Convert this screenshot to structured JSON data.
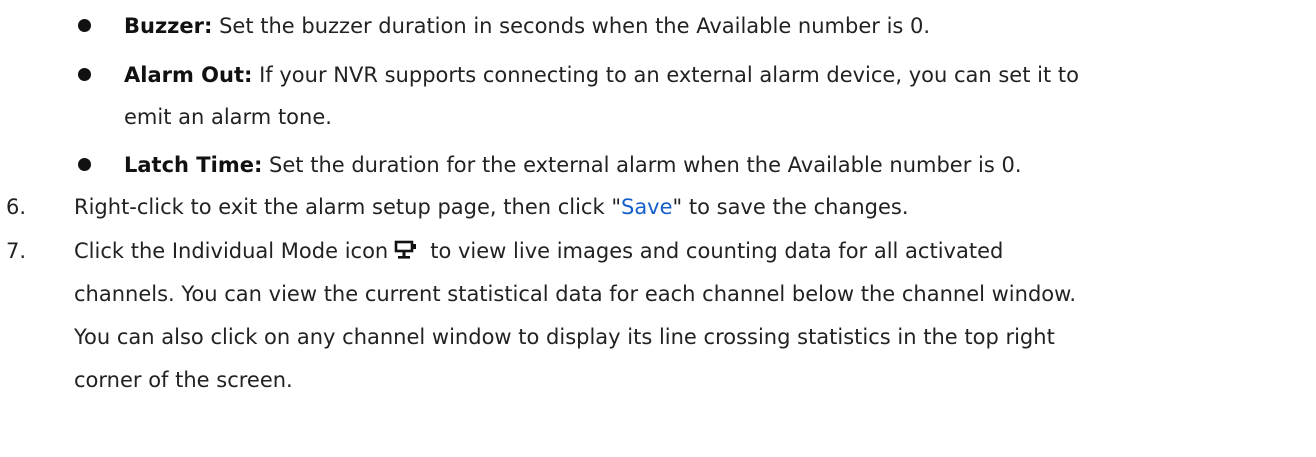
{
  "bullets": [
    {
      "term": "Buzzer:",
      "lines": [
        "Set the buzzer duration in seconds when the Available number is 0."
      ]
    },
    {
      "term": "Alarm Out:",
      "lines": [
        "If your NVR supports connecting to an external alarm device, you can set it to",
        "emit an alarm tone."
      ]
    },
    {
      "term": "Latch Time:",
      "lines": [
        "Set the duration for the external alarm when the Available number is 0."
      ]
    }
  ],
  "steps": [
    {
      "number": "6.",
      "before_link": "Right-click to exit the alarm setup page, then click \"",
      "link": "Save",
      "after_link": "\" to save the changes."
    },
    {
      "number": "7.",
      "before_icon": "Click the Individual Mode icon",
      "icon": "individual-mode-monitor-icon",
      "after_icon": "to view live images and counting data for all activated",
      "continuation": [
        "channels. You can view the current statistical data for each channel below the channel window.",
        "You can also click on any channel window to display its line crossing statistics in the top right",
        "corner of the screen."
      ]
    }
  ],
  "colors": {
    "link": "#1560c9",
    "text": "#222222",
    "bullet": "#111111"
  }
}
